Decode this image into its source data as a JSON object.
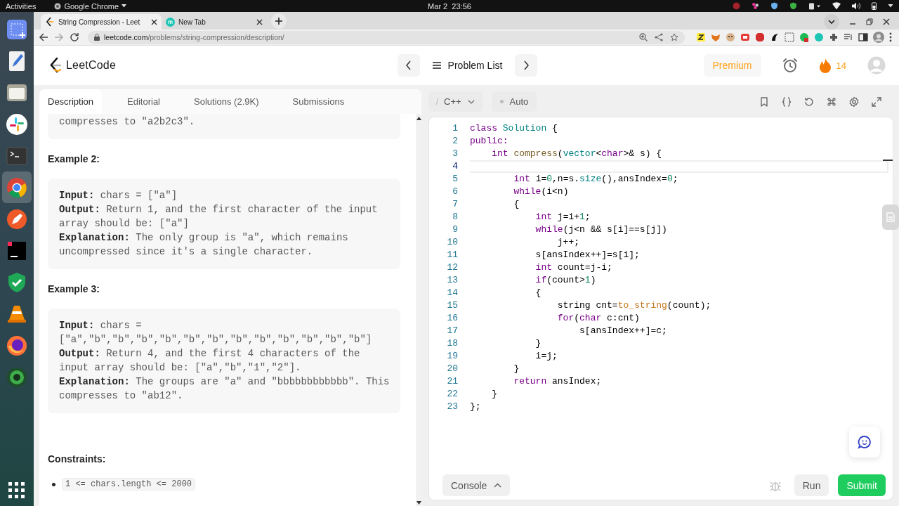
{
  "system_bar": {
    "activities": "Activities",
    "app_menu": "Google Chrome",
    "clock": "Mar 2  23:56"
  },
  "dock": [
    {
      "kind": "screenshot",
      "selected": false
    },
    {
      "kind": "editor",
      "selected": false
    },
    {
      "kind": "files",
      "selected": false
    },
    {
      "kind": "pinwheel",
      "selected": false
    },
    {
      "kind": "terminal",
      "selected": false
    },
    {
      "kind": "browser",
      "selected": true
    },
    {
      "kind": "pen",
      "selected": false
    },
    {
      "kind": "ide",
      "selected": false
    },
    {
      "kind": "shield",
      "selected": false
    },
    {
      "kind": "cone",
      "selected": false
    },
    {
      "kind": "fox",
      "selected": false
    },
    {
      "kind": "globe",
      "selected": false
    },
    {
      "kind": "apps",
      "selected": false
    }
  ],
  "browser": {
    "tabs": [
      {
        "title": "String Compression - Leet",
        "selected": true
      },
      {
        "title": "New Tab",
        "selected": false
      }
    ],
    "url_host": "leetcode.com",
    "url_path": "/problems/string-compression/description/"
  },
  "header": {
    "logo": "LeetCode",
    "problem_list": "Problem List",
    "premium": "Premium",
    "streak": "14"
  },
  "description": {
    "tabs": [
      {
        "label": "Description",
        "selected": true
      },
      {
        "label": "Editorial",
        "selected": false
      },
      {
        "label": "Solutions (2.9K)",
        "selected": false
      },
      {
        "label": "Submissions",
        "selected": false
      }
    ],
    "blocks": [
      {
        "kind": "example_tail",
        "lines": [
          "compresses to \"a2b2c3\"."
        ]
      },
      {
        "kind": "heading",
        "text": "Example 2:"
      },
      {
        "kind": "example",
        "lines": [
          "**Input:** chars = [\"a\"]",
          "**Output:** Return 1, and the first character of the input",
          "array should be: [\"a\"]",
          "**Explanation:** The only group is \"a\", which remains",
          "uncompressed since it's a single character."
        ]
      },
      {
        "kind": "heading",
        "text": "Example 3:"
      },
      {
        "kind": "example",
        "lines": [
          "**Input:** chars =",
          "[\"a\",\"b\",\"b\",\"b\",\"b\",\"b\",\"b\",\"b\",\"b\",\"b\",\"b\",\"b\",\"b\"]",
          "**Output:** Return 4, and the first 4 characters of the",
          "input array should be: [\"a\",\"b\",\"1\",\"2\"].",
          "**Explanation:** The groups are \"a\" and \"bbbbbbbbbbbb\". This",
          "compresses to \"ab12\"."
        ]
      },
      {
        "kind": "section",
        "text": "Constraints:"
      },
      {
        "kind": "bullets",
        "items": [
          {
            "code": "1 <= chars.length <= 2000"
          }
        ]
      }
    ]
  },
  "editor": {
    "language": "C++",
    "mode": "Auto",
    "lines": [
      {
        "number": "1",
        "current": false,
        "tokens": [
          {
            "kind": "kw",
            "text": "class"
          },
          {
            "kind": "type",
            "text": " Solution"
          },
          {
            "kind": "text",
            "text": " {"
          }
        ]
      },
      {
        "number": "2",
        "current": false,
        "tokens": [
          {
            "kind": "kw",
            "text": "public:"
          }
        ]
      },
      {
        "number": "3",
        "current": false,
        "tokens": [
          {
            "kind": "kw",
            "text": "    int"
          },
          {
            "kind": "def",
            "text": " compress"
          },
          {
            "kind": "text",
            "text": "("
          },
          {
            "kind": "type",
            "text": "vector"
          },
          {
            "kind": "text",
            "text": "<"
          },
          {
            "kind": "kw",
            "text": "char"
          },
          {
            "kind": "text",
            "text": ">& s) {"
          }
        ]
      },
      {
        "number": "4",
        "current": true
      },
      {
        "number": "5",
        "current": false,
        "tokens": [
          {
            "kind": "kw",
            "text": "        int"
          },
          {
            "kind": "text",
            "text": " i="
          },
          {
            "kind": "num",
            "text": "0"
          },
          {
            "kind": "text",
            "text": ",n=s."
          },
          {
            "kind": "prop",
            "text": "size"
          },
          {
            "kind": "text",
            "text": "(),ansIndex="
          },
          {
            "kind": "num",
            "text": "0"
          },
          {
            "kind": "text",
            "text": ";"
          }
        ]
      },
      {
        "number": "6",
        "current": false,
        "tokens": [
          {
            "kind": "kw",
            "text": "        while"
          },
          {
            "kind": "text",
            "text": "(i<n)"
          }
        ]
      },
      {
        "number": "7",
        "current": false,
        "tokens": [
          {
            "kind": "text",
            "text": "        {"
          }
        ]
      },
      {
        "number": "8",
        "current": false,
        "tokens": [
          {
            "kind": "kw",
            "text": "            int"
          },
          {
            "kind": "text",
            "text": " j=i+"
          },
          {
            "kind": "num",
            "text": "1"
          },
          {
            "kind": "text",
            "text": ";"
          }
        ]
      },
      {
        "number": "9",
        "current": false,
        "tokens": [
          {
            "kind": "kw",
            "text": "            while"
          },
          {
            "kind": "text",
            "text": "(j<n && s[i]==s[j])"
          }
        ]
      },
      {
        "number": "10",
        "current": false,
        "tokens": [
          {
            "kind": "text",
            "text": "                j++;"
          }
        ]
      },
      {
        "number": "11",
        "current": false,
        "tokens": [
          {
            "kind": "text",
            "text": "            s[ansIndex++]=s[i];"
          }
        ]
      },
      {
        "number": "12",
        "current": false,
        "tokens": [
          {
            "kind": "kw",
            "text": "            int"
          },
          {
            "kind": "text",
            "text": " count=j-i;"
          }
        ]
      },
      {
        "number": "13",
        "current": false,
        "tokens": [
          {
            "kind": "kw",
            "text": "            if"
          },
          {
            "kind": "text",
            "text": "(count>"
          },
          {
            "kind": "num",
            "text": "1"
          },
          {
            "kind": "text",
            "text": ")"
          }
        ]
      },
      {
        "number": "14",
        "current": false,
        "tokens": [
          {
            "kind": "text",
            "text": "            {"
          }
        ]
      },
      {
        "number": "15",
        "current": false,
        "tokens": [
          {
            "kind": "text",
            "text": "                string cnt="
          },
          {
            "kind": "builtin",
            "text": "to_string"
          },
          {
            "kind": "text",
            "text": "(count);"
          }
        ]
      },
      {
        "number": "16",
        "current": false,
        "tokens": [
          {
            "kind": "kw",
            "text": "                for"
          },
          {
            "kind": "text",
            "text": "("
          },
          {
            "kind": "kw",
            "text": "char"
          },
          {
            "kind": "text",
            "text": " c:cnt)"
          }
        ]
      },
      {
        "number": "17",
        "current": false,
        "tokens": [
          {
            "kind": "text",
            "text": "                    s[ansIndex++]=c;"
          }
        ]
      },
      {
        "number": "18",
        "current": false,
        "tokens": [
          {
            "kind": "text",
            "text": "            }"
          }
        ]
      },
      {
        "number": "19",
        "current": false,
        "tokens": [
          {
            "kind": "text",
            "text": "            i=j;"
          }
        ]
      },
      {
        "number": "20",
        "current": false,
        "tokens": [
          {
            "kind": "text",
            "text": "        }"
          }
        ]
      },
      {
        "number": "21",
        "current": false,
        "tokens": [
          {
            "kind": "kw",
            "text": "        return"
          },
          {
            "kind": "text",
            "text": " ansIndex;"
          }
        ]
      },
      {
        "number": "22",
        "current": false,
        "tokens": [
          {
            "kind": "text",
            "text": "    }"
          }
        ]
      },
      {
        "number": "23",
        "current": false,
        "tokens": [
          {
            "kind": "text",
            "text": "};"
          }
        ]
      }
    ],
    "console": "Console",
    "run": "Run",
    "submit": "Submit"
  }
}
